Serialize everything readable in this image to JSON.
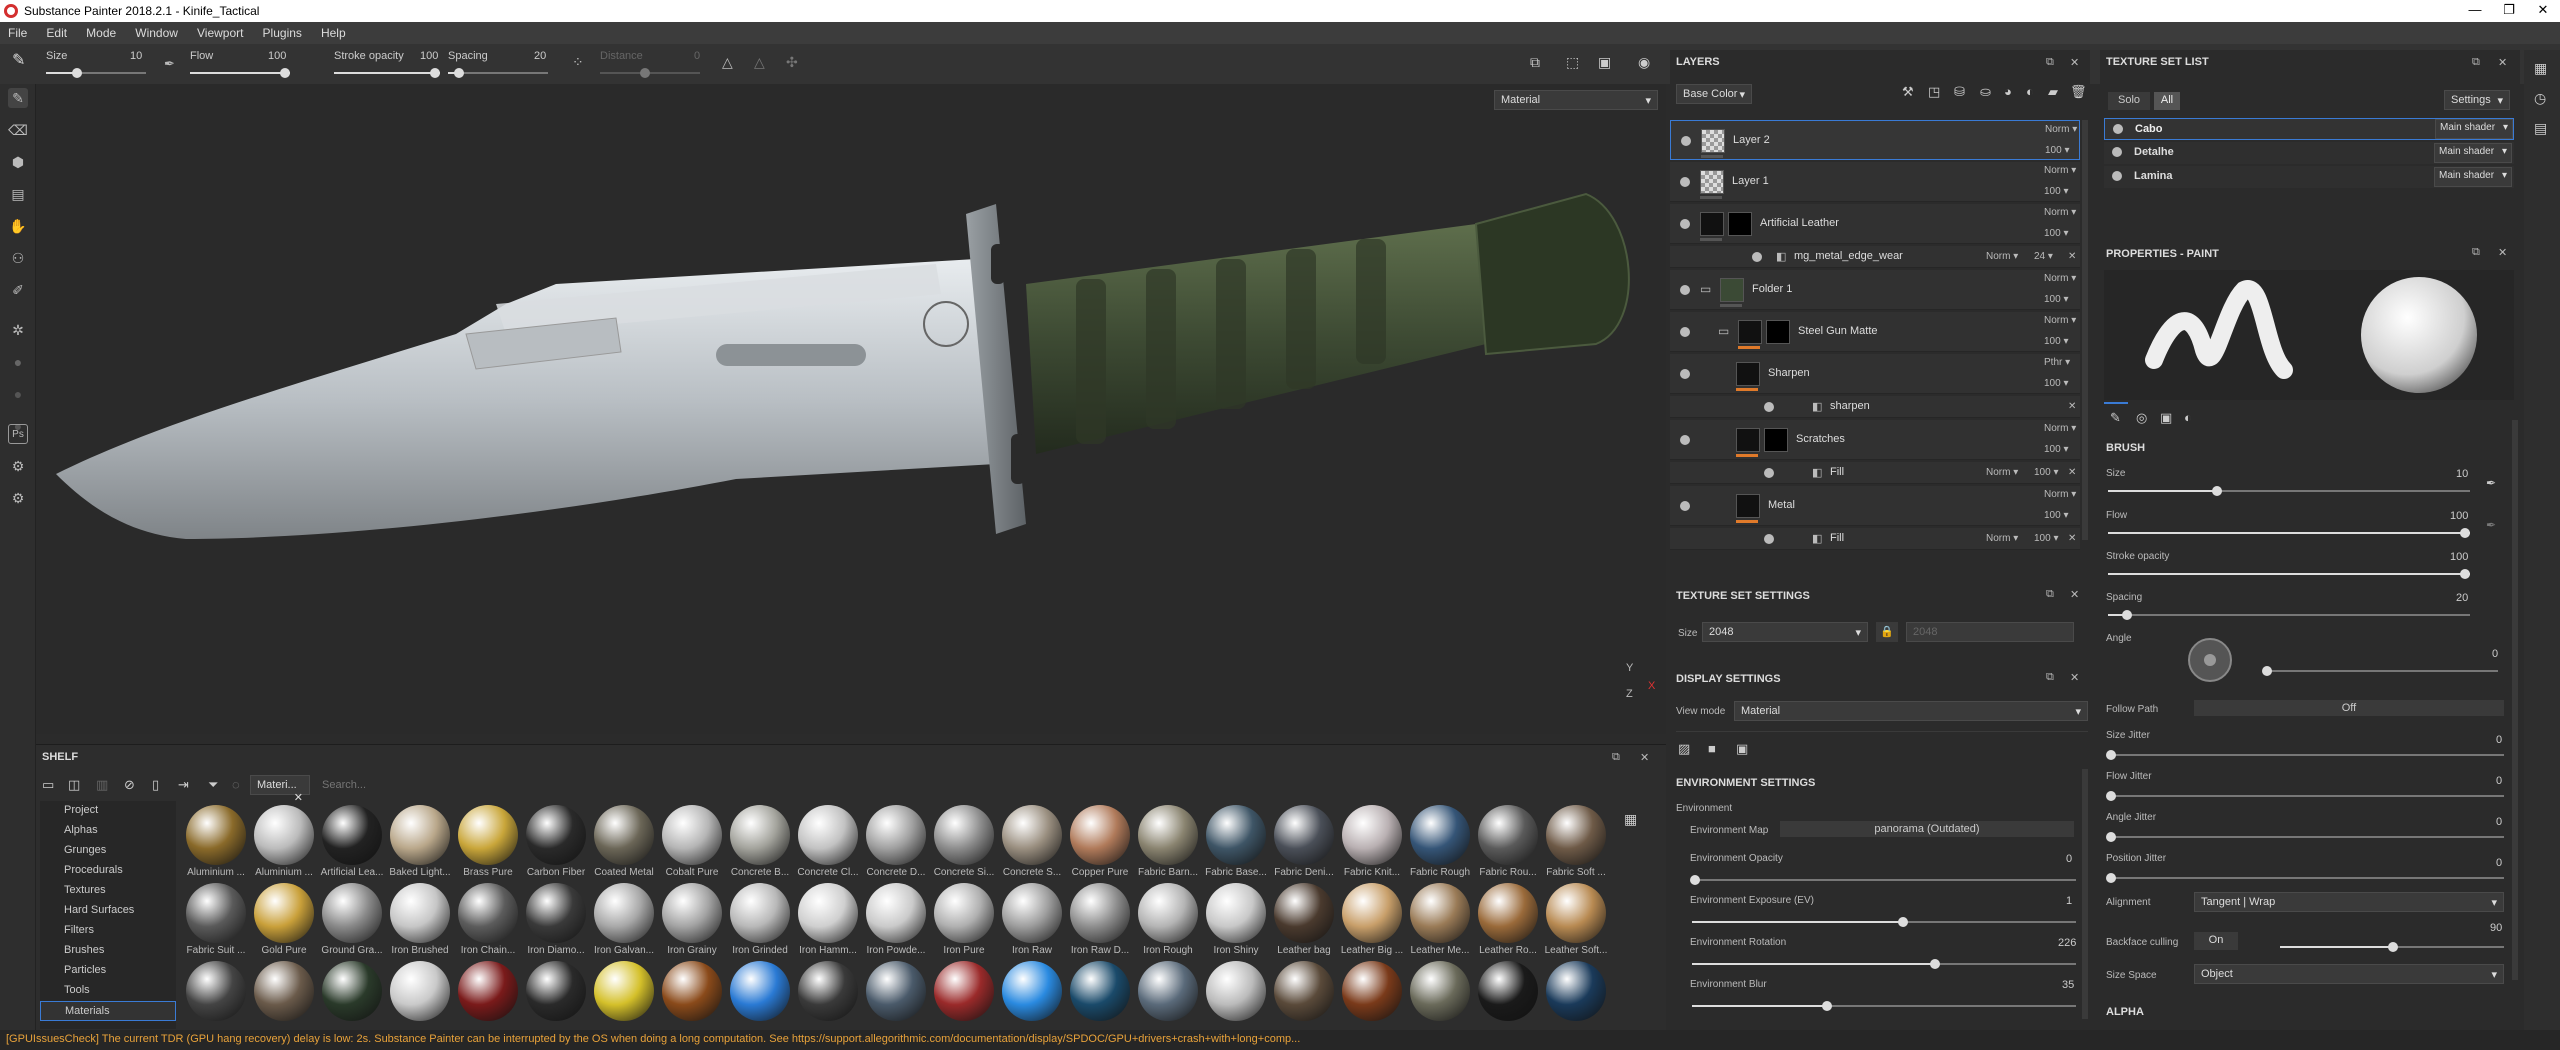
{
  "window": {
    "title": "Substance Painter 2018.2.1 - Kinife_Tactical",
    "min": "—",
    "max": "❐",
    "close": "✕"
  },
  "menu": [
    "File",
    "Edit",
    "Mode",
    "Window",
    "Viewport",
    "Plugins",
    "Help"
  ],
  "toolbar": {
    "size_label": "Size",
    "size_value": "10",
    "flow_label": "Flow",
    "flow_value": "100",
    "stroke_label": "Stroke opacity",
    "stroke_value": "100",
    "spacing_label": "Spacing",
    "spacing_value": "20",
    "distance_label": "Distance",
    "distance_value": "0"
  },
  "viewport": {
    "mode": "Material",
    "axis_y": "Y",
    "axis_z": "Z",
    "axis_x": "X"
  },
  "layers": {
    "title": "LAYERS",
    "channel": "Base Color",
    "rows": [
      {
        "name": "Layer 2",
        "blend": "Norm",
        "opacity": "100"
      },
      {
        "name": "Layer 1",
        "blend": "Norm",
        "opacity": "100"
      },
      {
        "name": "Artificial Leather",
        "blend": "Norm",
        "opacity": "100"
      },
      {
        "name": "mg_metal_edge_wear",
        "blend": "Norm",
        "opacity": "24"
      },
      {
        "name": "Folder 1",
        "blend": "Norm",
        "opacity": "100"
      },
      {
        "name": "Steel Gun Matte",
        "blend": "Norm",
        "opacity": "100"
      },
      {
        "name": "Sharpen",
        "blend": "Pthr",
        "opacity": "100"
      },
      {
        "name": "sharpen",
        "blend": "",
        "opacity": ""
      },
      {
        "name": "Scratches",
        "blend": "Norm",
        "opacity": "100"
      },
      {
        "name": "Fill",
        "blend": "Norm",
        "opacity": "100"
      },
      {
        "name": "Metal",
        "blend": "Norm",
        "opacity": "100"
      },
      {
        "name": "Fill",
        "blend": "Norm",
        "opacity": "100"
      }
    ]
  },
  "texture_set_settings": {
    "title": "TEXTURE SET SETTINGS",
    "size_label": "Size",
    "size_value": "2048",
    "size_value2": "2048"
  },
  "display_settings": {
    "title": "DISPLAY SETTINGS",
    "view_mode_label": "View mode",
    "view_mode": "Material",
    "env_title": "ENVIRONMENT SETTINGS",
    "env_label": "Environment",
    "env_map_label": "Environment Map",
    "env_map_value": "panorama (Outdated)",
    "opacity_label": "Environment Opacity",
    "opacity_value": "0",
    "exposure_label": "Environment Exposure (EV)",
    "exposure_value": "1",
    "rotation_label": "Environment Rotation",
    "rotation_value": "226",
    "blur_label": "Environment Blur",
    "blur_value": "35"
  },
  "texture_set_list": {
    "title": "TEXTURE SET LIST",
    "solo": "Solo",
    "all": "All",
    "settings": "Settings",
    "items": [
      {
        "name": "Cabo",
        "shader": "Main shader"
      },
      {
        "name": "Detalhe",
        "shader": "Main shader"
      },
      {
        "name": "Lamina",
        "shader": "Main shader"
      }
    ]
  },
  "properties": {
    "title": "PROPERTIES - PAINT",
    "brush_title": "BRUSH",
    "size_label": "Size",
    "size_value": "10",
    "flow_label": "Flow",
    "flow_value": "100",
    "stroke_label": "Stroke opacity",
    "stroke_value": "100",
    "spacing_label": "Spacing",
    "spacing_value": "20",
    "angle_label": "Angle",
    "angle_value": "0",
    "follow_label": "Follow Path",
    "follow_value": "Off",
    "size_jitter_label": "Size Jitter",
    "size_jitter_value": "0",
    "flow_jitter_label": "Flow Jitter",
    "flow_jitter_value": "0",
    "angle_jitter_label": "Angle Jitter",
    "angle_jitter_value": "0",
    "position_jitter_label": "Position Jitter",
    "position_jitter_value": "0",
    "alignment_label": "Alignment",
    "alignment_value": "Tangent | Wrap",
    "backface_label": "Backface culling",
    "backface_value": "On",
    "backface_num": "90",
    "size_space_label": "Size Space",
    "size_space_value": "Object",
    "alpha_title": "ALPHA"
  },
  "shelf": {
    "title": "SHELF",
    "filter_tag": "Materi...",
    "search_placeholder": "Search...",
    "categories": [
      "Project",
      "Alphas",
      "Grunges",
      "Procedurals",
      "Textures",
      "Hard Surfaces",
      "Filters",
      "Brushes",
      "Particles",
      "Tools",
      "Materials"
    ],
    "row1": [
      "Aluminium ...",
      "Aluminium ...",
      "Artificial Lea...",
      "Baked Light...",
      "Brass Pure",
      "Carbon Fiber",
      "Coated Metal",
      "Cobalt Pure",
      "Concrete B...",
      "Concrete Cl...",
      "Concrete D...",
      "Concrete Si...",
      "Concrete S...",
      "Copper Pure",
      "Fabric Barn...",
      "Fabric Base...",
      "Fabric Deni...",
      "Fabric Knit...",
      "Fabric Rough",
      "Fabric Rou...",
      "Fabric Soft ..."
    ],
    "row2": [
      "Fabric Suit ...",
      "Gold Pure",
      "Ground Gra...",
      "Iron Brushed",
      "Iron Chain...",
      "Iron Diamo...",
      "Iron Galvan...",
      "Iron Grainy",
      "Iron Grinded",
      "Iron Hamm...",
      "Iron Powde...",
      "Iron Pure",
      "Iron Raw",
      "Iron Raw D...",
      "Iron Rough",
      "Iron Shiny",
      "Leather bag",
      "Leather Big ...",
      "Leather Me...",
      "Leather Ro...",
      "Leather Soft..."
    ]
  },
  "status": "[GPUIssuesCheck] The current TDR (GPU hang recovery) delay is low: 2s. Substance Painter can be interrupted by the OS when doing a long computation. See https://support.allegorithmic.com/documentation/display/SPDOC/GPU+drivers+crash+with+long+comp..."
}
